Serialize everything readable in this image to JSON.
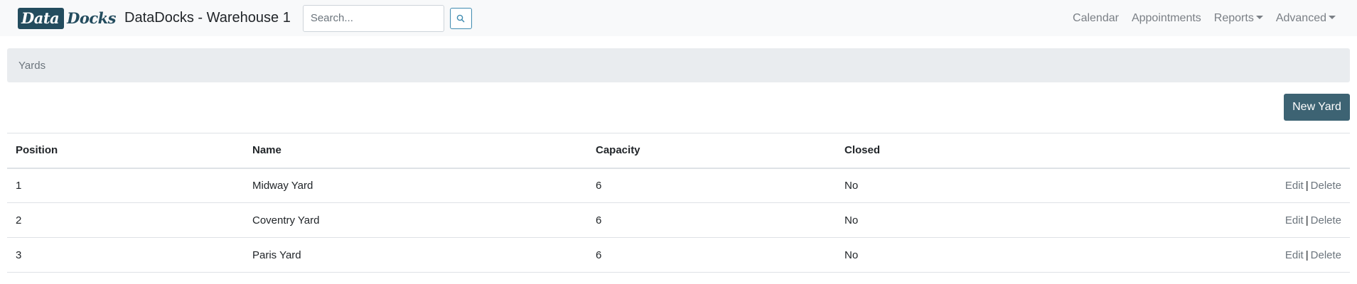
{
  "brand": {
    "logo_part1": "Data",
    "logo_part2": "Docks",
    "title": "DataDocks - Warehouse 1"
  },
  "search": {
    "placeholder": "Search...",
    "value": ""
  },
  "nav": {
    "calendar": "Calendar",
    "appointments": "Appointments",
    "reports": "Reports",
    "advanced": "Advanced"
  },
  "breadcrumb": {
    "current": "Yards"
  },
  "actions": {
    "new_label": "New Yard"
  },
  "table": {
    "headers": [
      "Position",
      "Name",
      "Capacity",
      "Closed"
    ],
    "rows": [
      {
        "position": "1",
        "name": "Midway Yard",
        "capacity": "6",
        "closed": "No",
        "edit": "Edit",
        "sep": "|",
        "delete": "Delete"
      },
      {
        "position": "2",
        "name": "Coventry Yard",
        "capacity": "6",
        "closed": "No",
        "edit": "Edit",
        "sep": "|",
        "delete": "Delete"
      },
      {
        "position": "3",
        "name": "Paris Yard",
        "capacity": "6",
        "closed": "No",
        "edit": "Edit",
        "sep": "|",
        "delete": "Delete"
      }
    ]
  },
  "colors": {
    "brand": "#234c5e",
    "primary_button": "#3d6373",
    "navbar_bg": "#f8f9fa",
    "breadcrumb_bg": "#e9ecef"
  },
  "icons": {
    "search_button": "search-icon",
    "dropdown": "caret-down-icon"
  }
}
